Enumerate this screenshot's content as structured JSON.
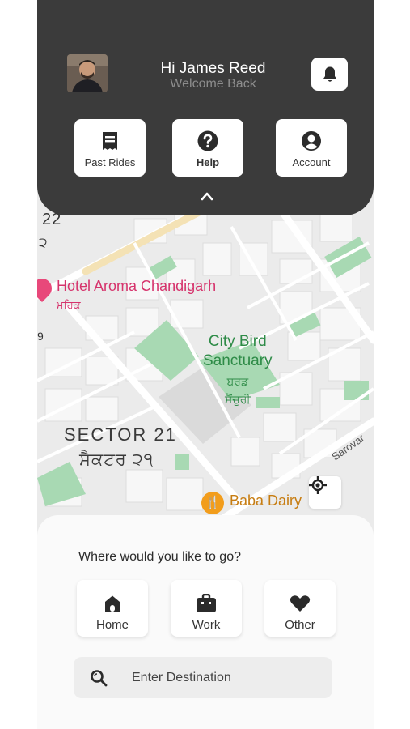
{
  "header": {
    "greeting": "Hi James Reed",
    "subtitle": "Welcome Back",
    "quick_actions": [
      {
        "label": "Past Rides",
        "icon": "receipt-icon"
      },
      {
        "label": "Help",
        "icon": "help-icon"
      },
      {
        "label": "Account",
        "icon": "account-icon"
      }
    ],
    "collapse_icon": "chevron-up-icon",
    "notification_icon": "bell-icon"
  },
  "map": {
    "labels": {
      "sector_22": "22",
      "sector_22_pa": "੨",
      "hotel": "Hotel Aroma Chandigarh",
      "hotel_pa": "ਮਹਿਕ",
      "nine": "9",
      "park_line1": "City Bird",
      "park_line2": "Sanctuary",
      "park_pa_line1": "ਬਰਡ",
      "park_pa_line2": "ਸੈਂਚੁਰੀ",
      "sector": "SECTOR 21",
      "sector_pa": "ਸੈਕਟਰ ੨੧",
      "sarovar": "Sarovar",
      "dairy": "Baba Dairy"
    },
    "locate_icon": "crosshair-icon"
  },
  "sheet": {
    "title": "Where would you like to go?",
    "places": [
      {
        "label": "Home",
        "icon": "home-icon"
      },
      {
        "label": "Work",
        "icon": "briefcase-icon"
      },
      {
        "label": "Other",
        "icon": "heart-icon"
      }
    ],
    "search_placeholder": "Enter Destination",
    "search_icon": "search-icon"
  },
  "colors": {
    "header_bg": "#3b3b3b",
    "map_bg": "#ebebeb",
    "park_green": "#a8d9b3",
    "hotel_pink": "#d6336c",
    "dairy_orange": "#f29d1c"
  }
}
